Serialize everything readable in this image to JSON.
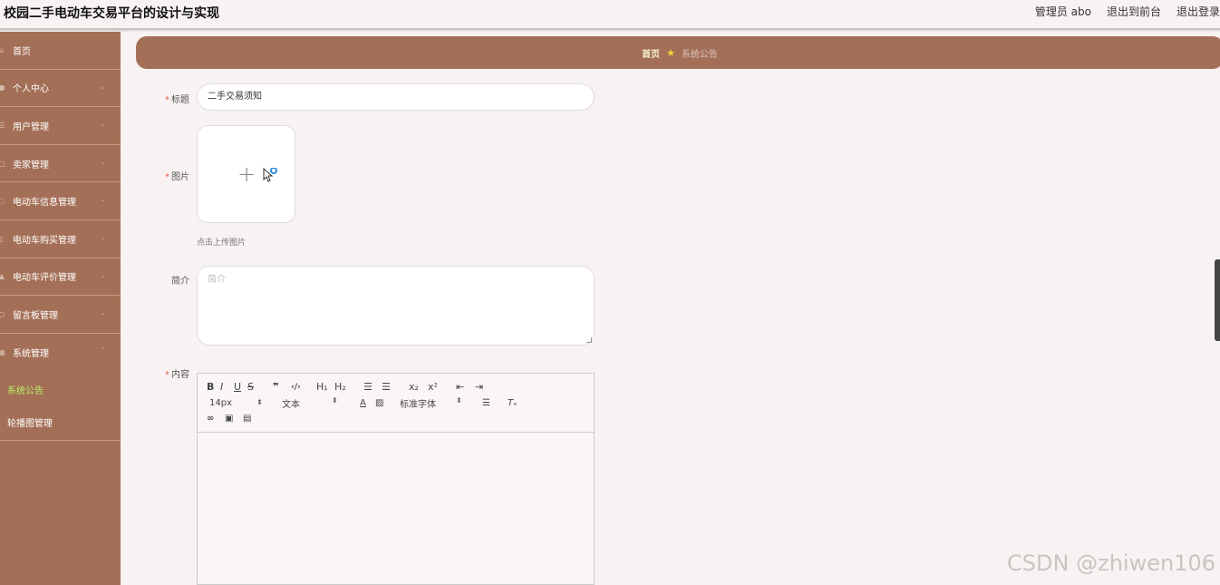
{
  "header": {
    "title": "校园二手电动车交易平台的设计与实现",
    "admin_label": "管理员 abo",
    "back_front_label": "退出到前台",
    "logout_label": "退出登录"
  },
  "sidebar": {
    "items": [
      {
        "label": "首页",
        "icon": "home-icon"
      },
      {
        "label": "个人中心",
        "icon": "user-icon"
      },
      {
        "label": "用户管理",
        "icon": "list-icon"
      },
      {
        "label": "卖家管理",
        "icon": "chat-icon"
      },
      {
        "label": "电动车信息管理",
        "icon": "circle-icon"
      },
      {
        "label": "电动车购买管理",
        "icon": "doc-icon"
      },
      {
        "label": "电动车评价管理",
        "icon": "thumb-icon"
      },
      {
        "label": "留言板管理",
        "icon": "message-icon"
      },
      {
        "label": "系统管理",
        "icon": "grid-icon"
      }
    ],
    "sub_items": [
      {
        "label": "系统公告",
        "active": true
      },
      {
        "label": "轮播图管理",
        "active": false
      }
    ]
  },
  "breadcrumb": {
    "home": "首页",
    "current": "系统公告"
  },
  "form": {
    "title_label": "标题",
    "title_value": "二手交易须知",
    "image_label": "图片",
    "upload_hint": "点击上传图片",
    "intro_label": "简介",
    "intro_placeholder": "简介",
    "content_label": "内容"
  },
  "editor": {
    "row1": [
      "B",
      "I",
      "U",
      "S",
      "❞",
      "‹/›",
      "H₁",
      "H₂",
      "☰",
      "☰",
      "x₂",
      "x²",
      "⇤",
      "⇥"
    ],
    "font_size": "14px",
    "text_style": "文本",
    "font_family": "标准字体"
  },
  "watermark": "CSDN @zhiwen106",
  "colors": {
    "sidebar_bg": "#a46f57",
    "page_bg": "#f8f3f2",
    "active_sub": "#b6ef6a",
    "required": "#e8604c"
  }
}
